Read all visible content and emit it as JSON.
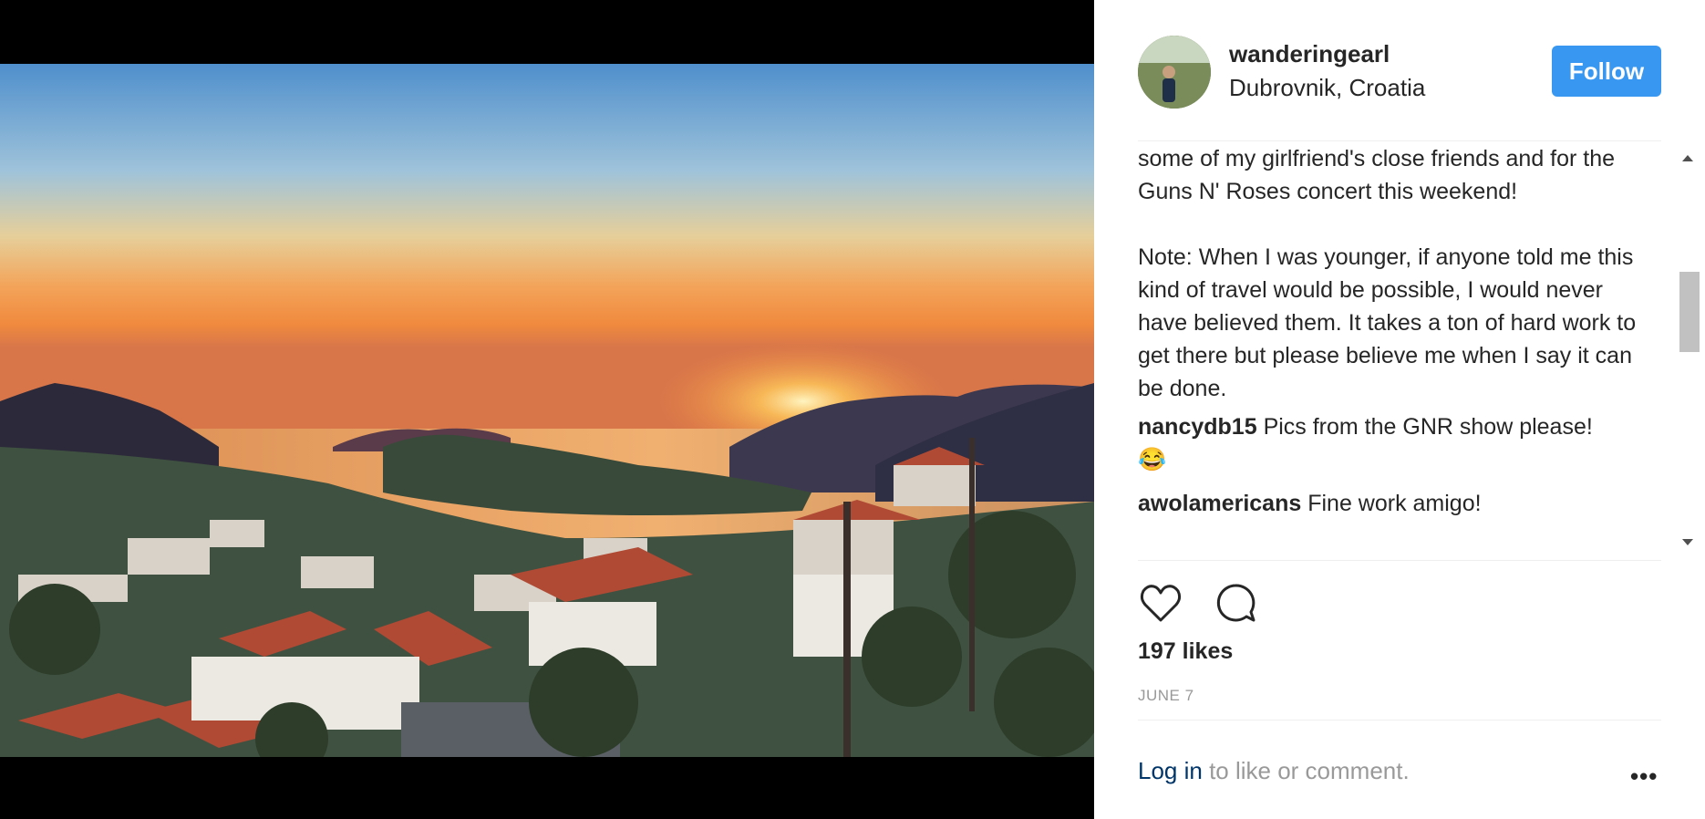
{
  "post": {
    "username": "wanderingearl",
    "location": "Dubrovnik, Croatia",
    "follow_label": "Follow",
    "caption_lines_1": "some of my girlfriend's close friends and for the Guns N' Roses concert this weekend!",
    "caption_lines_2": "Note: When I was younger, if anyone told me this kind of travel would be possible, I would never have believed them. It takes a ton of hard work to get there but please believe me when I say it can be done.",
    "comments": [
      {
        "user": "nancydb15",
        "text": "Pics from the GNR show please!",
        "emoji": "😂"
      },
      {
        "user": "awolamericans",
        "text": "Fine work amigo!"
      }
    ],
    "likes": "197 likes",
    "date": "JUNE 7",
    "login_link": "Log in",
    "login_rest": " to like or comment.",
    "more_label": "•••"
  },
  "icons": [
    "heart-icon",
    "comment-icon"
  ]
}
